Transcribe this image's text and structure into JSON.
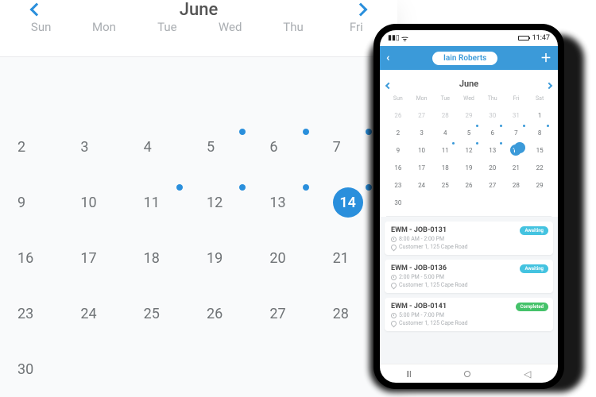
{
  "desktop": {
    "month": "June",
    "daynames": [
      "Sun",
      "Mon",
      "Tue",
      "Wed",
      "Thu",
      "Fri"
    ],
    "weeks": [
      [
        null,
        null,
        null,
        null,
        null,
        null
      ],
      [
        2,
        3,
        4,
        5,
        6,
        7
      ],
      [
        9,
        10,
        11,
        12,
        13,
        14
      ],
      [
        16,
        17,
        18,
        19,
        20,
        21
      ],
      [
        23,
        24,
        25,
        26,
        27,
        28
      ],
      [
        30,
        null,
        null,
        null,
        null,
        null
      ]
    ],
    "dotted": [
      5,
      6,
      7,
      11,
      12,
      13,
      14
    ],
    "selected": 14
  },
  "phone": {
    "status_time": "11:47",
    "user_name": "Iain Roberts",
    "month": "June",
    "daynames": [
      "Sun",
      "Mon",
      "Tue",
      "Wed",
      "Thu",
      "Fri",
      "Sat"
    ],
    "prev_trailing": [
      26,
      27,
      28,
      29,
      30,
      31
    ],
    "days": [
      1,
      2,
      3,
      4,
      5,
      6,
      7,
      8,
      9,
      10,
      11,
      12,
      13,
      14,
      15,
      16,
      17,
      18,
      19,
      20,
      21,
      22,
      23,
      24,
      25,
      26,
      27,
      28,
      29,
      30
    ],
    "dotted": [
      5,
      6,
      7,
      8,
      11,
      12,
      13,
      14
    ],
    "selected": 14,
    "jobs": [
      {
        "ref": "EWM - JOB-0131",
        "time": "8:00 AM - 2:00 PM",
        "loc": "Customer 1, 125 Cape Road",
        "status": "Awaiting",
        "status_kind": "awaiting"
      },
      {
        "ref": "EWM - JOB-0136",
        "time": "2:00 PM - 5:00 PM",
        "loc": "Customer 1, 125 Cape Road",
        "status": "Awaiting",
        "status_kind": "awaiting"
      },
      {
        "ref": "EWM - JOB-0141",
        "time": "5:00 PM - 7:00 PM",
        "loc": "Customer 1, 125 Cape Road",
        "status": "Completed",
        "status_kind": "completed"
      }
    ]
  }
}
